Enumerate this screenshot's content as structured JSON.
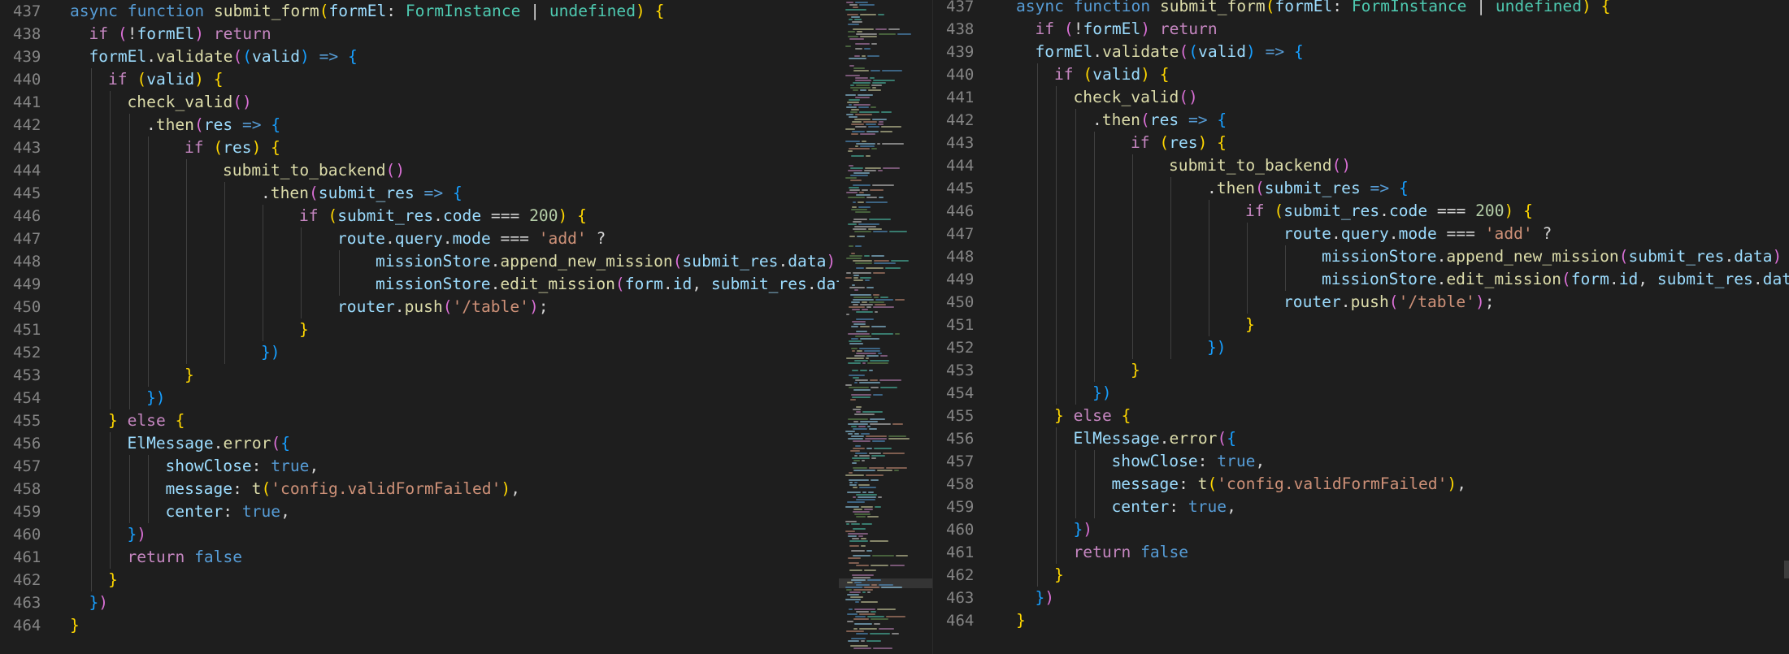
{
  "editor": {
    "accent": "#007acc",
    "theme_colors": {
      "background": "#1e1e1e",
      "keyword": "#569cd6",
      "control": "#c586c0",
      "function": "#dcdcaa",
      "variable": "#9cdcfe",
      "type": "#4ec9b0",
      "string": "#ce9178",
      "number": "#b5cea8",
      "line_number": "#858585"
    }
  },
  "left_pane": {
    "line_numbers": [
      "437",
      "438",
      "439",
      "440",
      "441",
      "442",
      "443",
      "444",
      "445",
      "446",
      "447",
      "448",
      "449",
      "450",
      "451",
      "452",
      "453",
      "454",
      "455",
      "456",
      "457",
      "458",
      "459",
      "460",
      "461",
      "462",
      "463",
      "464"
    ]
  },
  "right_pane": {
    "line_numbers": [
      "437",
      "438",
      "439",
      "440",
      "441",
      "442",
      "443",
      "444",
      "445",
      "446",
      "447",
      "448",
      "449",
      "450",
      "451",
      "452",
      "453",
      "454",
      "455",
      "456",
      "457",
      "458",
      "459",
      "460",
      "461",
      "462",
      "463",
      "464"
    ]
  },
  "code_lines": [
    {
      "indent": 0,
      "tokens": [
        [
          "kw",
          "async "
        ],
        [
          "kw",
          "function "
        ],
        [
          "fn",
          "submit_form"
        ],
        [
          "b1",
          "("
        ],
        [
          "var",
          "formEl"
        ],
        [
          "p",
          ": "
        ],
        [
          "ty",
          "FormInstance"
        ],
        [
          "p",
          " | "
        ],
        [
          "ty",
          "undefined"
        ],
        [
          "b1",
          ")"
        ],
        [
          "p",
          " "
        ],
        [
          "b1",
          "{"
        ]
      ]
    },
    {
      "indent": 1,
      "tokens": [
        [
          "ctl",
          "if "
        ],
        [
          "b2",
          "("
        ],
        [
          "p",
          "!"
        ],
        [
          "var",
          "formEl"
        ],
        [
          "b2",
          ")"
        ],
        [
          "p",
          " "
        ],
        [
          "ctl",
          "return"
        ]
      ]
    },
    {
      "indent": 1,
      "tokens": [
        [
          "var",
          "formEl"
        ],
        [
          "p",
          "."
        ],
        [
          "fn",
          "validate"
        ],
        [
          "b2",
          "("
        ],
        [
          "b3",
          "("
        ],
        [
          "var",
          "valid"
        ],
        [
          "b3",
          ")"
        ],
        [
          "p",
          " "
        ],
        [
          "kw",
          "=>"
        ],
        [
          "p",
          " "
        ],
        [
          "b3",
          "{"
        ]
      ]
    },
    {
      "indent": 2,
      "tokens": [
        [
          "ctl",
          "if "
        ],
        [
          "b1",
          "("
        ],
        [
          "var",
          "valid"
        ],
        [
          "b1",
          ")"
        ],
        [
          "p",
          " "
        ],
        [
          "b1",
          "{"
        ]
      ]
    },
    {
      "indent": 3,
      "tokens": [
        [
          "fn",
          "check_valid"
        ],
        [
          "b2",
          "()"
        ]
      ]
    },
    {
      "indent": 4,
      "tokens": [
        [
          "p",
          "."
        ],
        [
          "fn",
          "then"
        ],
        [
          "b2",
          "("
        ],
        [
          "var",
          "res"
        ],
        [
          "p",
          " "
        ],
        [
          "kw",
          "=>"
        ],
        [
          "p",
          " "
        ],
        [
          "b3",
          "{"
        ]
      ]
    },
    {
      "indent": 6,
      "tokens": [
        [
          "ctl",
          "if "
        ],
        [
          "b1",
          "("
        ],
        [
          "var",
          "res"
        ],
        [
          "b1",
          ")"
        ],
        [
          "p",
          " "
        ],
        [
          "b1",
          "{"
        ]
      ]
    },
    {
      "indent": 8,
      "tokens": [
        [
          "fn",
          "submit_to_backend"
        ],
        [
          "b2",
          "()"
        ]
      ]
    },
    {
      "indent": 10,
      "tokens": [
        [
          "p",
          "."
        ],
        [
          "fn",
          "then"
        ],
        [
          "b2",
          "("
        ],
        [
          "var",
          "submit_res"
        ],
        [
          "p",
          " "
        ],
        [
          "kw",
          "=>"
        ],
        [
          "p",
          " "
        ],
        [
          "b3",
          "{"
        ]
      ]
    },
    {
      "indent": 12,
      "tokens": [
        [
          "ctl",
          "if "
        ],
        [
          "b1",
          "("
        ],
        [
          "var",
          "submit_res"
        ],
        [
          "p",
          "."
        ],
        [
          "var",
          "code"
        ],
        [
          "p",
          " === "
        ],
        [
          "num",
          "200"
        ],
        [
          "b1",
          ")"
        ],
        [
          "p",
          " "
        ],
        [
          "b1",
          "{"
        ]
      ]
    },
    {
      "indent": 14,
      "tokens": [
        [
          "var",
          "route"
        ],
        [
          "p",
          "."
        ],
        [
          "var",
          "query"
        ],
        [
          "p",
          "."
        ],
        [
          "var",
          "mode"
        ],
        [
          "p",
          " === "
        ],
        [
          "str",
          "'add'"
        ],
        [
          "p",
          " ?"
        ]
      ]
    },
    {
      "indent": 16,
      "tokens": [
        [
          "var",
          "missionStore"
        ],
        [
          "p",
          "."
        ],
        [
          "fn",
          "append_new_mission"
        ],
        [
          "b2",
          "("
        ],
        [
          "var",
          "submit_res"
        ],
        [
          "p",
          "."
        ],
        [
          "var",
          "data"
        ],
        [
          "b2",
          ")"
        ],
        [
          "p",
          " :"
        ]
      ]
    },
    {
      "indent": 16,
      "tokens": [
        [
          "var",
          "missionStore"
        ],
        [
          "p",
          "."
        ],
        [
          "fn",
          "edit_mission"
        ],
        [
          "b2",
          "("
        ],
        [
          "var",
          "form"
        ],
        [
          "p",
          "."
        ],
        [
          "var",
          "id"
        ],
        [
          "p",
          ", "
        ],
        [
          "var",
          "submit_res"
        ],
        [
          "p",
          "."
        ],
        [
          "var",
          "data"
        ],
        [
          "b2",
          ")"
        ]
      ]
    },
    {
      "indent": 14,
      "tokens": [
        [
          "var",
          "router"
        ],
        [
          "p",
          "."
        ],
        [
          "fn",
          "push"
        ],
        [
          "b2",
          "("
        ],
        [
          "str",
          "'/table'"
        ],
        [
          "b2",
          ")"
        ],
        [
          "p",
          ";"
        ]
      ]
    },
    {
      "indent": 12,
      "tokens": [
        [
          "b1",
          "}"
        ]
      ]
    },
    {
      "indent": 10,
      "tokens": [
        [
          "b3",
          "})"
        ]
      ]
    },
    {
      "indent": 6,
      "tokens": [
        [
          "b1",
          "}"
        ]
      ]
    },
    {
      "indent": 4,
      "tokens": [
        [
          "b3",
          "})"
        ]
      ]
    },
    {
      "indent": 2,
      "tokens": [
        [
          "b1",
          "}"
        ],
        [
          "p",
          " "
        ],
        [
          "ctl",
          "else "
        ],
        [
          "b1",
          "{"
        ]
      ]
    },
    {
      "indent": 3,
      "tokens": [
        [
          "var",
          "ElMessage"
        ],
        [
          "p",
          "."
        ],
        [
          "fn",
          "error"
        ],
        [
          "b2",
          "("
        ],
        [
          "b3",
          "{"
        ]
      ]
    },
    {
      "indent": 5,
      "tokens": [
        [
          "var",
          "showClose"
        ],
        [
          "p",
          ": "
        ],
        [
          "kw",
          "true"
        ],
        [
          "p",
          ","
        ]
      ]
    },
    {
      "indent": 5,
      "tokens": [
        [
          "var",
          "message"
        ],
        [
          "p",
          ": "
        ],
        [
          "fn",
          "t"
        ],
        [
          "b1",
          "("
        ],
        [
          "str",
          "'config.validFormFailed'"
        ],
        [
          "b1",
          ")"
        ],
        [
          "p",
          ","
        ]
      ]
    },
    {
      "indent": 5,
      "tokens": [
        [
          "var",
          "center"
        ],
        [
          "p",
          ": "
        ],
        [
          "kw",
          "true"
        ],
        [
          "p",
          ","
        ]
      ]
    },
    {
      "indent": 3,
      "tokens": [
        [
          "b3",
          "}"
        ],
        [
          "b2",
          ")"
        ]
      ]
    },
    {
      "indent": 3,
      "tokens": [
        [
          "ctl",
          "return "
        ],
        [
          "kw",
          "false"
        ]
      ]
    },
    {
      "indent": 2,
      "tokens": [
        [
          "b1",
          "}"
        ]
      ]
    },
    {
      "indent": 1,
      "tokens": [
        [
          "b3",
          "}"
        ],
        [
          "b2",
          ")"
        ]
      ]
    },
    {
      "indent": 0,
      "tokens": [
        [
          "b1",
          "}"
        ]
      ]
    }
  ]
}
